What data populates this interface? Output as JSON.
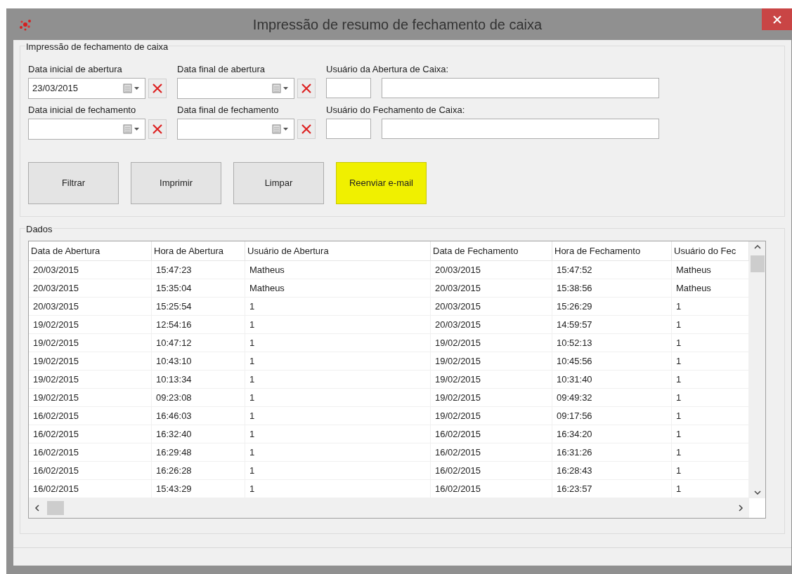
{
  "window": {
    "title": "Impressão de resumo de fechamento de caixa"
  },
  "filter_group": {
    "title": "Impressão de fechamento de caixa",
    "rows": [
      {
        "date_start": {
          "label": "Data inicial de abertura",
          "value": "23/03/2015"
        },
        "date_end": {
          "label": "Data final de abertura"
        },
        "user_label": "Usuário da Abertura de Caixa:"
      },
      {
        "date_start": {
          "label": "Data inicial de fechamento"
        },
        "date_end": {
          "label": "Data final de fechamento"
        },
        "user_label": "Usuário do Fechamento de Caixa:"
      }
    ]
  },
  "buttons": [
    {
      "label": "Filtrar",
      "highlighted": false
    },
    {
      "label": "Imprimir",
      "highlighted": false
    },
    {
      "label": "Limpar",
      "highlighted": false
    },
    {
      "label": "Reenviar e-mail",
      "highlighted": true
    }
  ],
  "data_group": {
    "title": "Dados",
    "table": {
      "columns": [
        "Data de Abertura",
        "Hora de Abertura",
        "Usuário de Abertura",
        "Data de Fechamento",
        "Hora de Fechamento",
        "Usuário do Fec"
      ],
      "rows": [
        [
          "20/03/2015",
          "15:47:23",
          "Matheus",
          "20/03/2015",
          "15:47:52",
          "Matheus"
        ],
        [
          "20/03/2015",
          "15:35:04",
          "Matheus",
          "20/03/2015",
          "15:38:56",
          "Matheus"
        ],
        [
          "20/03/2015",
          "15:25:54",
          "1",
          "20/03/2015",
          "15:26:29",
          "1"
        ],
        [
          "19/02/2015",
          "12:54:16",
          "1",
          "20/03/2015",
          "14:59:57",
          "1"
        ],
        [
          "19/02/2015",
          "10:47:12",
          "1",
          "19/02/2015",
          "10:52:13",
          "1"
        ],
        [
          "19/02/2015",
          "10:43:10",
          "1",
          "19/02/2015",
          "10:45:56",
          "1"
        ],
        [
          "19/02/2015",
          "10:13:34",
          "1",
          "19/02/2015",
          "10:31:40",
          "1"
        ],
        [
          "19/02/2015",
          "09:23:08",
          "1",
          "19/02/2015",
          "09:49:32",
          "1"
        ],
        [
          "16/02/2015",
          "16:46:03",
          "1",
          "19/02/2015",
          "09:17:56",
          "1"
        ],
        [
          "16/02/2015",
          "16:32:40",
          "1",
          "16/02/2015",
          "16:34:20",
          "1"
        ],
        [
          "16/02/2015",
          "16:29:48",
          "1",
          "16/02/2015",
          "16:31:26",
          "1"
        ],
        [
          "16/02/2015",
          "16:26:28",
          "1",
          "16/02/2015",
          "16:28:43",
          "1"
        ],
        [
          "16/02/2015",
          "15:43:29",
          "1",
          "16/02/2015",
          "16:23:57",
          "1"
        ]
      ]
    }
  }
}
